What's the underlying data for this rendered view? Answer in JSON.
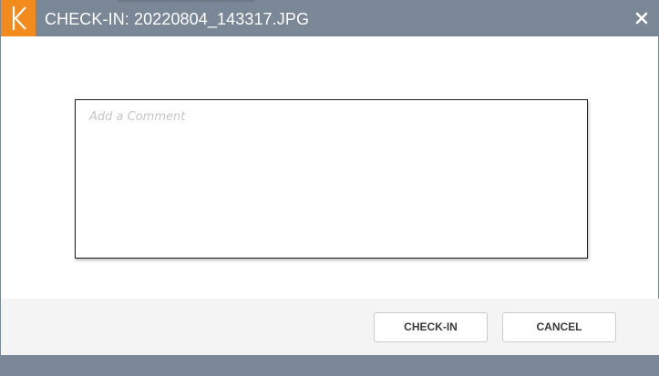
{
  "dialog": {
    "title": "CHECK-IN: 20220804_143317.JPG",
    "logo_icon": "k-logo-icon",
    "close_icon": "close-icon"
  },
  "comment": {
    "placeholder": "Add a Comment",
    "value": ""
  },
  "buttons": {
    "checkin_label": "CHECK-IN",
    "cancel_label": "CANCEL"
  },
  "colors": {
    "titlebar": "#7a8796",
    "brand_orange": "#f28a1e",
    "footer": "#f4f4f4"
  }
}
